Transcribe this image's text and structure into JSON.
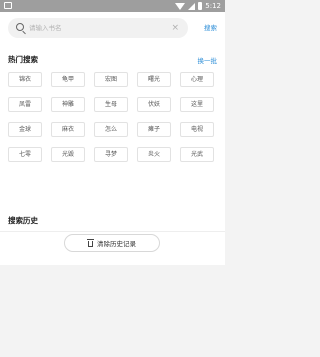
{
  "status_bar": {
    "time": "5:12"
  },
  "search": {
    "placeholder": "请输入书名",
    "clear_glyph": "×",
    "button_label": "搜索"
  },
  "hot_search": {
    "title": "热门搜索",
    "refresh_label": "换一批",
    "tags": [
      "锦衣",
      "龟甲",
      "宏图",
      "曙光",
      "心理",
      "凤雷",
      "神雕",
      "生母",
      "伏妖",
      "这里",
      "金球",
      "麻衣",
      "怎么",
      "瘫子",
      "电视",
      "七零",
      "光毁",
      "寻梦",
      "炎火",
      "光武"
    ]
  },
  "history": {
    "title": "搜索历史",
    "clear_label": "清除历史记录"
  },
  "colors": {
    "accent": "#2f8fd8",
    "status_bar": "#9e9e9e",
    "page_bg": "#f3f3f3"
  },
  "icons": {
    "app": "app-icon",
    "wifi": "wifi-icon",
    "signal": "signal-icon",
    "battery": "battery-icon",
    "search": "search-icon",
    "clear": "clear-icon",
    "trash": "trash-icon"
  }
}
